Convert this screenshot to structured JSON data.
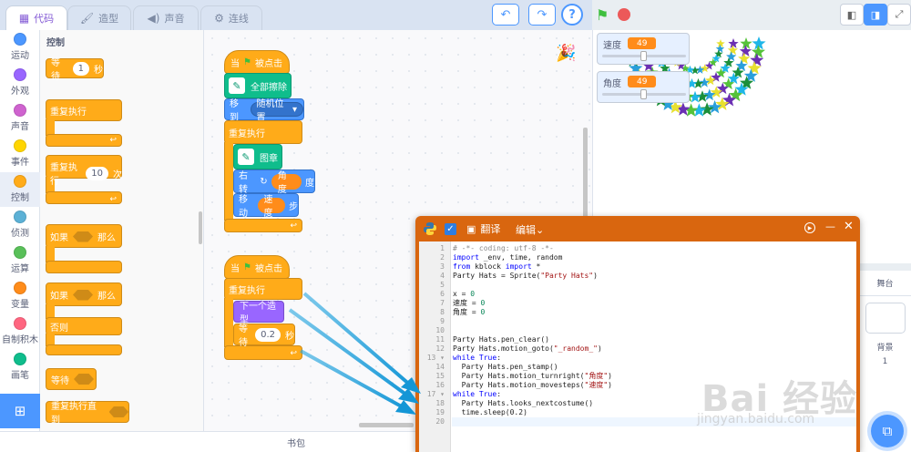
{
  "tabs": [
    {
      "label": "代码",
      "icon": "code-icon",
      "active": true
    },
    {
      "label": "造型",
      "icon": "brush-icon",
      "active": false
    },
    {
      "label": "声音",
      "icon": "speaker-icon",
      "active": false
    },
    {
      "label": "连线",
      "icon": "connect-icon",
      "active": false
    }
  ],
  "toolbar": {
    "undo": "↶",
    "redo": "↷",
    "help": "?"
  },
  "categories": [
    {
      "label": "运动",
      "color": "#4c97ff"
    },
    {
      "label": "外观",
      "color": "#9966ff"
    },
    {
      "label": "声音",
      "color": "#cf63cf"
    },
    {
      "label": "事件",
      "color": "#ffd500"
    },
    {
      "label": "控制",
      "color": "#ffab19",
      "selected": true
    },
    {
      "label": "侦测",
      "color": "#5cb1d6"
    },
    {
      "label": "运算",
      "color": "#59c059"
    },
    {
      "label": "变量",
      "color": "#ff8c1a"
    },
    {
      "label": "自制积木",
      "color": "#ff6680"
    },
    {
      "label": "画笔",
      "color": "#0fbd8c"
    }
  ],
  "palette": {
    "title": "控制",
    "wait_label": "等待",
    "wait_value": "1",
    "wait_unit": "秒",
    "forever": "重复执行",
    "repeat": "重复执行",
    "repeat_value": "10",
    "repeat_unit": "次",
    "if": "如果",
    "then": "那么",
    "if2": "如果",
    "then2": "那么",
    "else": "否则",
    "wait_until": "等待",
    "repeat_until": "重复执行直到"
  },
  "script1": {
    "hat_when": "当",
    "hat_clicked": "被点击",
    "clear": "全部擦除",
    "goto": "移到",
    "goto_target": "随机位置",
    "forever": "重复执行",
    "stamp": "图章",
    "turn": "右转",
    "turn_var": "角度",
    "turn_unit": "度",
    "move": "移动",
    "move_var": "速度",
    "move_unit": "步"
  },
  "script2": {
    "hat_when": "当",
    "hat_clicked": "被点击",
    "forever": "重复执行",
    "next_costume": "下一个造型",
    "wait": "等待",
    "wait_value": "0.2",
    "wait_unit": "秒"
  },
  "monitors": [
    {
      "label": "速度",
      "value": "49",
      "fraction": 0.49
    },
    {
      "label": "角度",
      "value": "49",
      "fraction": 0.49
    }
  ],
  "code_window": {
    "translate": "翻译",
    "edit": "编辑",
    "lines": [
      "# -*- coding: utf-8 -*-",
      "import _env, time, random",
      "from kblock import *",
      "Party Hats = Sprite(\"Party Hats\")",
      "",
      "x = 0",
      "速度 = 0",
      "角度 = 0",
      "",
      "",
      "Party Hats.pen_clear()",
      "Party Hats.motion_goto(\"_random_\")",
      "while True:",
      "  Party Hats.pen_stamp()",
      "  Party Hats.motion_turnright(\"角度\")",
      "  Party Hats.motion_movesteps(\"速度\")",
      "while True:",
      "  Party Hats.looks_nextcostume()",
      "  time.sleep(0.2)",
      ""
    ]
  },
  "stage_panel": {
    "stage_label": "舞台",
    "backdrop_label": "背景",
    "backdrop_count": "1"
  },
  "backpack": "书包",
  "watermark": {
    "main": "Bai 经验",
    "sub": "jingyan.baidu.com"
  }
}
